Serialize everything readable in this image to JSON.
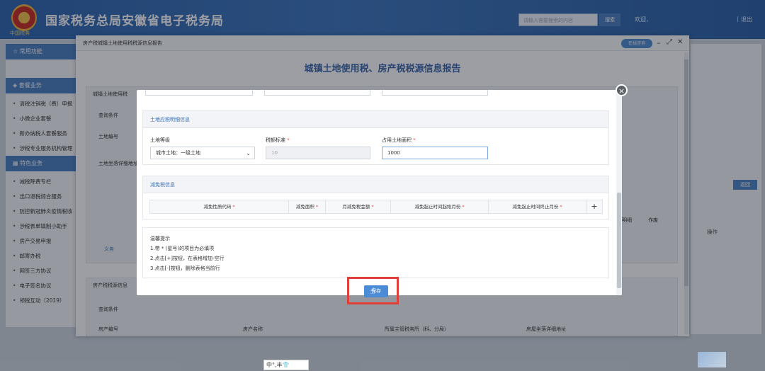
{
  "header": {
    "emblem_text": "中国税务",
    "title": "国家税务总局安徽省电子税务局",
    "search_placeholder": "请输入需要搜索的内容",
    "search_button": "搜索",
    "welcome": "欢迎，",
    "logout": "退出"
  },
  "sidebar": {
    "sections": [
      {
        "title": "常用功能",
        "items": []
      },
      {
        "title": "套餐业务",
        "items": [
          "清税注销税（费）申报",
          "小微企业套餐",
          "新办纳税人套餐服务",
          "涉税专业服务机构管理"
        ]
      },
      {
        "title": "特色业务",
        "items": [
          "减税降费专栏",
          "出口退税综合服务",
          "防控新冠肺炎疫情税收",
          "涉税表单填制小助手",
          "房产交易申报",
          "邮寄办税",
          "网签三方协议",
          "电子签名协议",
          "领税互动（2019）"
        ]
      }
    ]
  },
  "right_panel": {
    "back_button": "返回",
    "operation_label": "操作"
  },
  "dialog": {
    "title": "房产税城镇土地使用税税源信息报告",
    "online_help": "在线咨询",
    "heading": "城镇土地使用税、房产税税源信息报告",
    "bg_labels": {
      "land_section": "城镇土地使用税",
      "query": "查询条件",
      "land_no": "土地编号",
      "land_addr": "土地坐落详细地址",
      "house_section": "房产税税源信息",
      "query2": "查询条件",
      "house_no": "房产编号",
      "house_name": "房产名称",
      "tax_office": "所属主管税务所（科、分局）",
      "house_addr": "房屋坐落详细地址",
      "col_op": "操作",
      "radio_text": "义务",
      "extra_btn_a": "明细",
      "extra_btn_b": "作废"
    }
  },
  "modal": {
    "land_tax_section": {
      "title": "土地应税明细信息",
      "land_grade_label": "土地等级",
      "land_grade_value": "城市土地：一级土地",
      "tax_standard_label": "税额标准",
      "tax_standard_value": "10",
      "area_label": "占用土地面积",
      "area_value": "1000"
    },
    "relief_section": {
      "title": "减免税信息",
      "columns": [
        "减免性质代码",
        "减免面积",
        "月减免税金额",
        "减免起止时间起始月份",
        "减免起止时间终止月份"
      ],
      "add_label": "+"
    },
    "tips": {
      "title": "温馨提示",
      "lines": [
        "1.带 * (星号)的项目为必填项",
        "2.点击[+]按钮，在表格增加-空行",
        "3.点击[-]按钮，删除表格当前行"
      ]
    },
    "save_button": "保存"
  },
  "taskbar": {
    "ime_text": "中°,半👕"
  }
}
